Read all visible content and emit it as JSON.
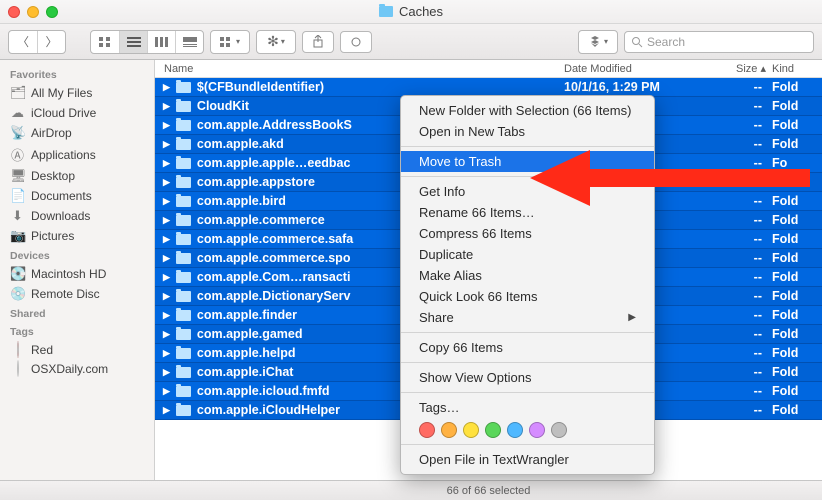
{
  "window": {
    "title": "Caches"
  },
  "toolbar": {
    "search_placeholder": "Search"
  },
  "sidebar": {
    "sections": [
      {
        "header": "Favorites",
        "items": [
          {
            "icon": "allfiles",
            "label": "All My Files"
          },
          {
            "icon": "icloud",
            "label": "iCloud Drive"
          },
          {
            "icon": "airdrop",
            "label": "AirDrop"
          },
          {
            "icon": "apps",
            "label": "Applications"
          },
          {
            "icon": "desktop",
            "label": "Desktop"
          },
          {
            "icon": "docs",
            "label": "Documents"
          },
          {
            "icon": "down",
            "label": "Downloads"
          },
          {
            "icon": "pics",
            "label": "Pictures"
          }
        ]
      },
      {
        "header": "Devices",
        "items": [
          {
            "icon": "hd",
            "label": "Macintosh HD"
          },
          {
            "icon": "disc",
            "label": "Remote Disc"
          }
        ]
      },
      {
        "header": "Shared",
        "items": []
      },
      {
        "header": "Tags",
        "items": [
          {
            "icon": "tagred",
            "label": "Red",
            "color": "#ff5f57"
          },
          {
            "icon": "tagosx",
            "label": "OSXDaily.com",
            "color": "#ffffff"
          }
        ]
      }
    ]
  },
  "columns": {
    "name": "Name",
    "date": "Date Modified",
    "size": "Size",
    "size_caret": "▴",
    "kind": "Kind"
  },
  "rows": [
    {
      "name": "$(CFBundleIdentifier)",
      "date": "10/1/16, 1:29 PM",
      "size": "--",
      "kind": "Fold"
    },
    {
      "name": "CloudKit",
      "date": "",
      "size": "--",
      "kind": "Fold"
    },
    {
      "name": "com.apple.AddressBookS",
      "date": "",
      "size": "--",
      "kind": "Fold"
    },
    {
      "name": "com.apple.akd",
      "date": "",
      "size": "--",
      "kind": "Fold"
    },
    {
      "name": "com.apple.apple…eedbac",
      "date": "",
      "size": "--",
      "kind": "Fo"
    },
    {
      "name": "com.apple.appstore",
      "date": "",
      "size": "--",
      "kind": "Fold"
    },
    {
      "name": "com.apple.bird",
      "date": "",
      "size": "--",
      "kind": "Fold"
    },
    {
      "name": "com.apple.commerce",
      "date": "",
      "size": "--",
      "kind": "Fold"
    },
    {
      "name": "com.apple.commerce.safa",
      "date": "",
      "size": "--",
      "kind": "Fold"
    },
    {
      "name": "com.apple.commerce.spo",
      "date": "",
      "size": "--",
      "kind": "Fold"
    },
    {
      "name": "com.apple.Com…ransacti",
      "date": "",
      "size": "--",
      "kind": "Fold"
    },
    {
      "name": "com.apple.DictionaryServ",
      "date": "",
      "size": "--",
      "kind": "Fold"
    },
    {
      "name": "com.apple.finder",
      "date": "",
      "size": "--",
      "kind": "Fold"
    },
    {
      "name": "com.apple.gamed",
      "date": "",
      "size": "--",
      "kind": "Fold"
    },
    {
      "name": "com.apple.helpd",
      "date": "",
      "size": "--",
      "kind": "Fold"
    },
    {
      "name": "com.apple.iChat",
      "date": "",
      "size": "--",
      "kind": "Fold"
    },
    {
      "name": "com.apple.icloud.fmfd",
      "date": "",
      "size": "--",
      "kind": "Fold"
    },
    {
      "name": "com.apple.iCloudHelper",
      "date": "",
      "size": "--",
      "kind": "Fold"
    }
  ],
  "status": "66 of 66 selected",
  "context_menu": {
    "groups": [
      [
        "New Folder with Selection (66 Items)",
        "Open in New Tabs"
      ],
      [
        "Move to Trash"
      ],
      [
        "Get Info",
        "Rename 66 Items…",
        "Compress 66 Items",
        "Duplicate",
        "Make Alias",
        "Quick Look 66 Items",
        "Share"
      ],
      [
        "Copy 66 Items"
      ],
      [
        "Show View Options"
      ],
      [
        "Tags…"
      ],
      [
        "Open File in TextWrangler"
      ]
    ],
    "highlighted": "Move to Trash",
    "share_has_submenu": true,
    "tag_colors": [
      "#ff6b63",
      "#ffb242",
      "#ffe13e",
      "#5ad65a",
      "#4fb8ff",
      "#d58cff",
      "#bfbfbf"
    ]
  }
}
